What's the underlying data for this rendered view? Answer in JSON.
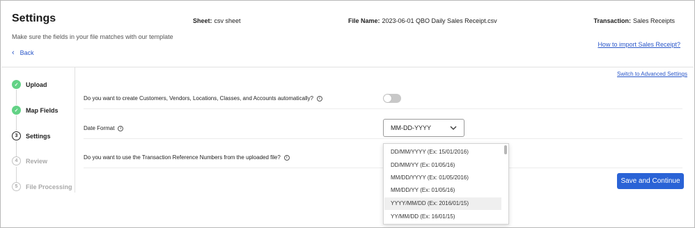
{
  "header": {
    "title": "Settings",
    "subtitle": "Make sure the fields in your file matches with our template",
    "back_label": "Back",
    "sheet_label": "Sheet:",
    "sheet_value": "csv sheet",
    "file_label": "File Name:",
    "file_value": "2023-06-01 QBO Daily Sales Receipt.csv",
    "transaction_label": "Transaction:",
    "transaction_value": "Sales Receipts",
    "howto_link": "How to import Sales Receipt?"
  },
  "steps": [
    {
      "label": "Upload",
      "marker": "✓",
      "state": "done"
    },
    {
      "label": "Map Fields",
      "marker": "✓",
      "state": "done"
    },
    {
      "label": "Settings",
      "marker": "3",
      "state": "current"
    },
    {
      "label": "Review",
      "marker": "4",
      "state": "future"
    },
    {
      "label": "File Processing",
      "marker": "5",
      "state": "future"
    }
  ],
  "settings": {
    "advanced_link": "Switch to Advanced Settings",
    "q_auto_create": "Do you want to create Customers, Vendors, Locations, Classes, and Accounts automatically?",
    "auto_create_enabled": false,
    "q_date_format": "Date Format",
    "date_format_selected": "MM-DD-YYYY",
    "q_ref_numbers": "Do you want to use the Transaction Reference Numbers from the uploaded file?",
    "info_glyph": "i"
  },
  "dropdown": {
    "options": [
      "DD/MM/YYYY (Ex: 15/01/2016)",
      "DD/MM/YY (Ex: 01/05/16)",
      "MM/DD/YYYY (Ex: 01/05/2016)",
      "MM/DD/YY (Ex: 01/05/16)",
      "YYYY/MM/DD (Ex: 2016/01/15)",
      "YY/MM/DD (Ex: 16/01/15)"
    ],
    "highlighted_index": 4
  },
  "actions": {
    "save_label": "Save and Continue"
  },
  "colors": {
    "accent": "#2a63d6",
    "link": "#2a57c9",
    "step_done": "#63d286"
  }
}
